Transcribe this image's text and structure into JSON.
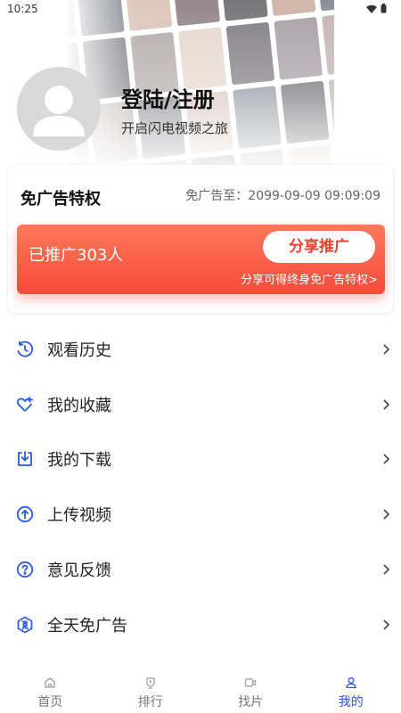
{
  "status_bar": {
    "time": "10:25",
    "icons": [
      "wifi-icon",
      "battery-icon"
    ]
  },
  "profile": {
    "login_title": "登陆/注册",
    "subtitle": "开启闪电视频之旅"
  },
  "adfree": {
    "title": "免广告特权",
    "expire_text": "免广告至：2099-09-09 09:09:09",
    "promo_count_text": "已推广303人",
    "share_button": "分享推广",
    "share_hint": "分享可得终身免广告特权>"
  },
  "menu": [
    {
      "label": "观看历史",
      "icon": "history-icon"
    },
    {
      "label": "我的收藏",
      "icon": "heart-icon"
    },
    {
      "label": "我的下载",
      "icon": "download-icon"
    },
    {
      "label": "上传视频",
      "icon": "upload-icon"
    },
    {
      "label": "意见反馈",
      "icon": "feedback-icon"
    },
    {
      "label": "全天免广告",
      "icon": "ad-free-icon"
    }
  ],
  "bottom_nav": [
    {
      "label": "首页",
      "icon": "home-icon",
      "active": false
    },
    {
      "label": "排行",
      "icon": "ranking-icon",
      "active": false
    },
    {
      "label": "找片",
      "icon": "find-video-icon",
      "active": false
    },
    {
      "label": "我的",
      "icon": "profile-icon",
      "active": true
    }
  ],
  "colors": {
    "accent": "#2b55e6",
    "promo_red": "#f7493a",
    "icon_blue": "#2a58e8"
  }
}
